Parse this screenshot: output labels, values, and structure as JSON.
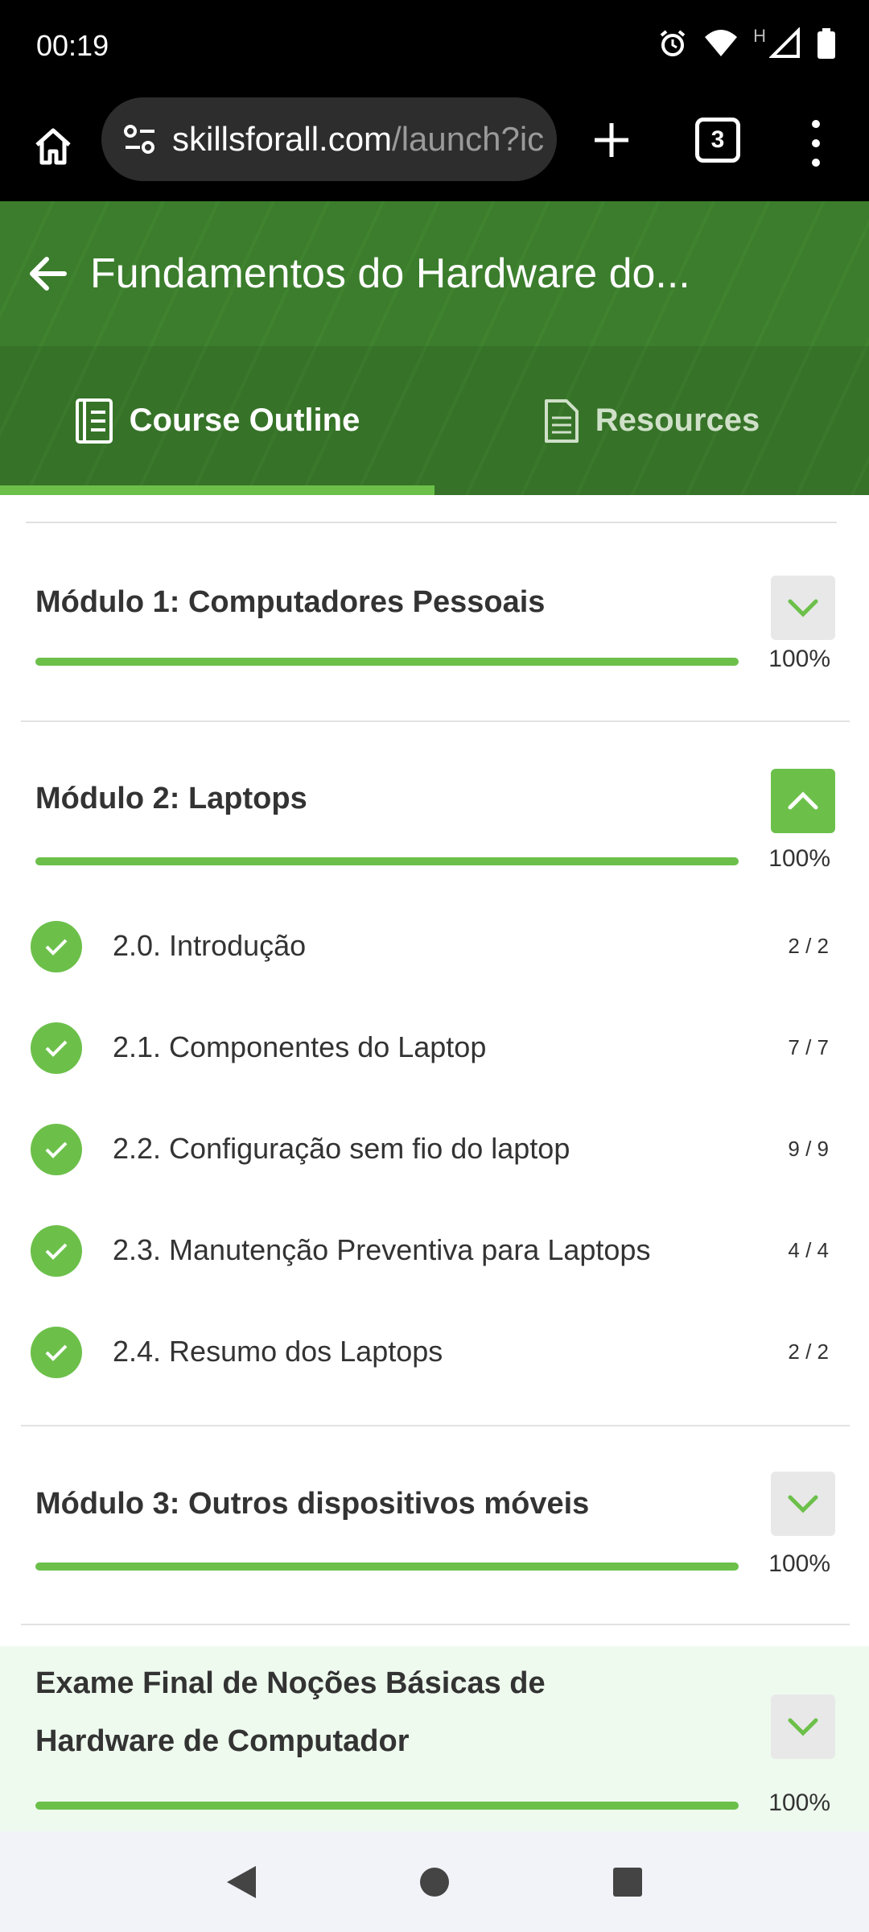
{
  "status_bar": {
    "time": "00:19",
    "icons": [
      "alarm-icon",
      "wifi-icon",
      "signal-icon",
      "battery-icon"
    ],
    "network_letter": "H"
  },
  "browser": {
    "url_host": "skillsforall.com",
    "url_rest": "/launch?ic",
    "tab_count": "3"
  },
  "header": {
    "course_title": "Fundamentos do Hardware do...",
    "tabs": [
      {
        "label": "Course Outline",
        "icon": "outline-icon",
        "active": true
      },
      {
        "label": "Resources",
        "icon": "document-icon",
        "active": false
      }
    ]
  },
  "modules": [
    {
      "title": "Módulo 1: Computadores Pessoais",
      "progress": 100,
      "progress_label": "100%",
      "expanded": false
    },
    {
      "title": "Módulo 2: Laptops",
      "progress": 100,
      "progress_label": "100%",
      "expanded": true,
      "lessons": [
        {
          "title": "2.0. Introdução",
          "count": "2 / 2"
        },
        {
          "title": "2.1. Componentes do Laptop",
          "count": "7 / 7"
        },
        {
          "title": "2.2. Configuração sem fio do laptop",
          "count": "9 / 9"
        },
        {
          "title": "2.3. Manutenção Preventiva para Laptops",
          "count": "4 / 4"
        },
        {
          "title": "2.4. Resumo dos Laptops",
          "count": "2 / 2"
        }
      ]
    },
    {
      "title": "Módulo 3: Outros dispositivos móveis",
      "progress": 100,
      "progress_label": "100%",
      "expanded": false
    }
  ],
  "exam": {
    "title_line1": "Exame Final de Noções Básicas de",
    "title_line2": "Hardware de Computador",
    "progress": 100,
    "progress_label": "100%"
  },
  "colors": {
    "accent": "#6cc04a",
    "header_green": "#3b7d2c",
    "exam_bg": "#eefaee"
  }
}
